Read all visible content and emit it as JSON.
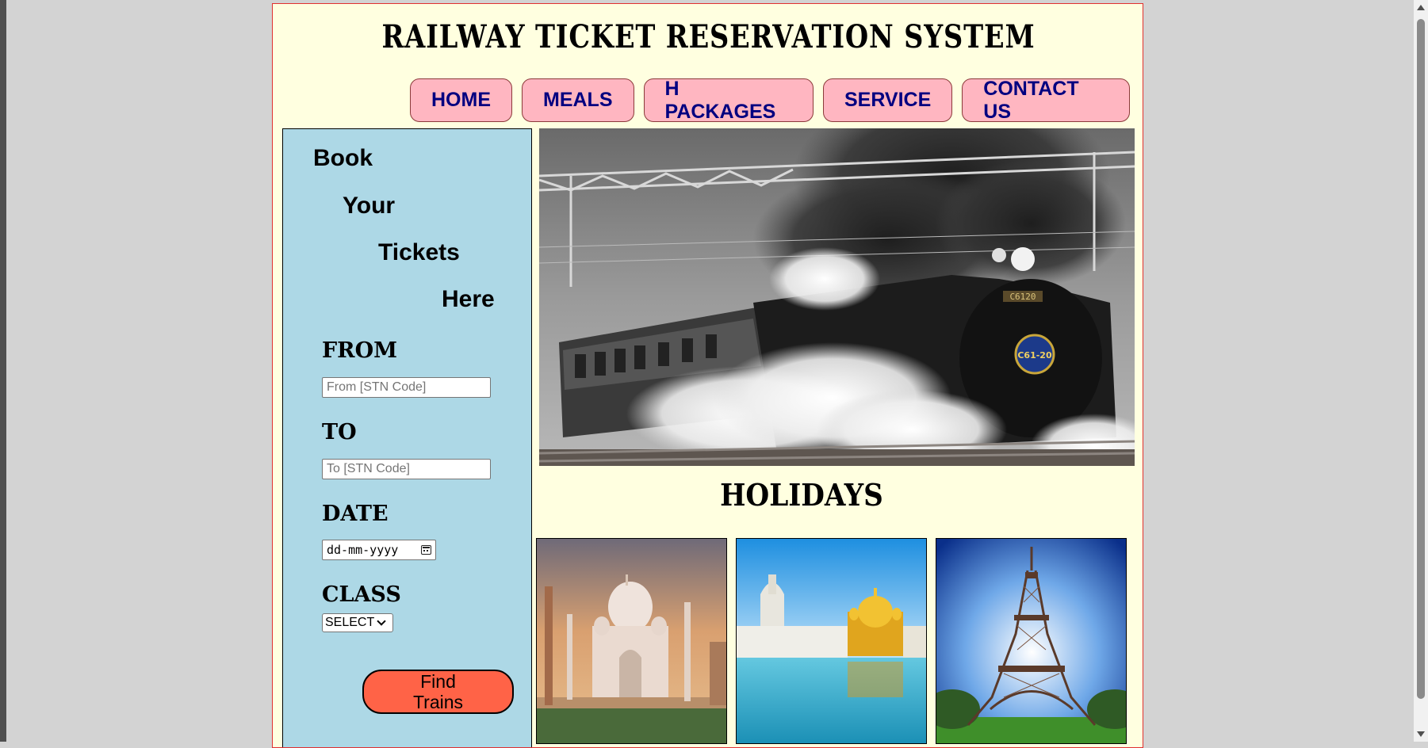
{
  "header": {
    "title": "RAILWAY TICKET RESERVATION SYSTEM"
  },
  "nav": {
    "items": [
      {
        "label": "HOME"
      },
      {
        "label": "MEALS"
      },
      {
        "label": "H PACKAGES"
      },
      {
        "label": "SERVICE"
      },
      {
        "label": "CONTACT US"
      }
    ]
  },
  "booking": {
    "heading": [
      "Book",
      "Your",
      "Tickets",
      "Here"
    ],
    "from_label": "FROM",
    "from_placeholder": "From [STN Code]",
    "to_label": "TO",
    "to_placeholder": "To [STN Code]",
    "date_label": "DATE",
    "date_placeholder": "dd-mm-yyyy",
    "class_label": "CLASS",
    "class_selected": "SELECT",
    "find_label": "Find Trains"
  },
  "holidays": {
    "title": "HOLIDAYS",
    "cards": [
      "taj-mahal",
      "golden-temple",
      "eiffel-tower"
    ]
  },
  "colors": {
    "page_bg": "#ffffe0",
    "nav_bg": "#ffb6c1",
    "nav_text": "#000080",
    "sidebar_bg": "#add8e6",
    "find_button_bg": "#ff6347",
    "page_border": "#e03030"
  }
}
